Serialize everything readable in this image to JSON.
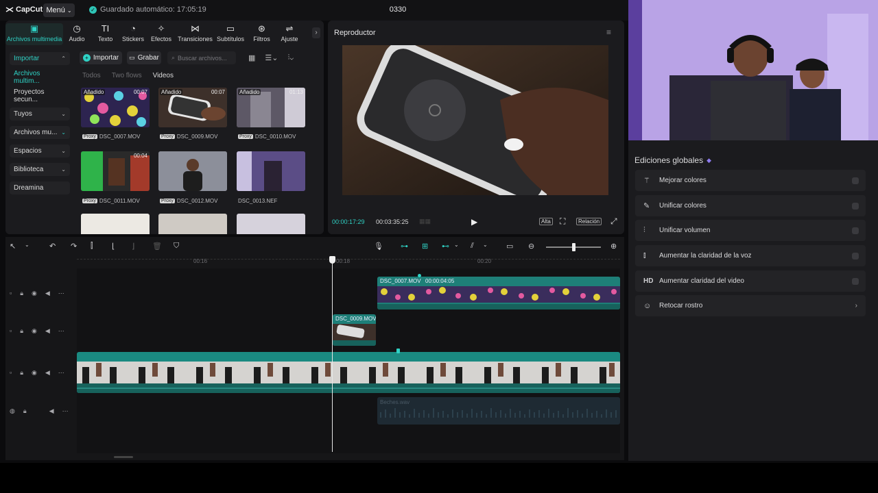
{
  "app": {
    "logo": "CapCut",
    "menu_label": "Menú",
    "autosave": "Guardado automático: 17:05:19",
    "project_title": "0330"
  },
  "toolbar_tabs": [
    {
      "label": "Archivos multimedia",
      "icon": "media-icon"
    },
    {
      "label": "Audio",
      "icon": "audio-icon"
    },
    {
      "label": "Texto",
      "icon": "text-icon"
    },
    {
      "label": "Stickers",
      "icon": "sticker-icon"
    },
    {
      "label": "Efectos",
      "icon": "effects-icon"
    },
    {
      "label": "Transiciones",
      "icon": "transition-icon"
    },
    {
      "label": "Subtítulos",
      "icon": "subtitle-icon"
    },
    {
      "label": "Filtros",
      "icon": "filter-icon"
    },
    {
      "label": "Ajuste",
      "icon": "adjust-icon"
    }
  ],
  "side_nav": [
    {
      "label": "Importar"
    },
    {
      "label": "Archivos multim..."
    },
    {
      "label": "Proyectos secun..."
    },
    {
      "label": "Tuyos"
    },
    {
      "label": "Archivos mu..."
    },
    {
      "label": "Espacios"
    },
    {
      "label": "Biblioteca"
    },
    {
      "label": "Dreamina"
    }
  ],
  "media": {
    "import_label": "Importar",
    "record_label": "Grabar",
    "search_placeholder": "Buscar archivos...",
    "filters": [
      "Todos",
      "Two flows",
      "Videos"
    ],
    "items": [
      {
        "tag": "Añadido",
        "duration": "00:07",
        "name": "DSC_0007.MOV",
        "proxy": "Proxy"
      },
      {
        "tag": "Añadido",
        "duration": "00:07",
        "name": "DSC_0009.MOV",
        "proxy": "Proxy"
      },
      {
        "tag": "Añadido",
        "duration": "01:13",
        "name": "DSC_0010.MOV",
        "proxy": "Proxy"
      },
      {
        "tag": "",
        "duration": "00:04",
        "name": "DSC_0011.MOV",
        "proxy": "Proxy"
      },
      {
        "tag": "",
        "duration": "",
        "name": "DSC_0012.MOV",
        "proxy": "Proxy"
      },
      {
        "tag": "",
        "duration": "",
        "name": "DSC_0013.NEF",
        "proxy": ""
      }
    ]
  },
  "player": {
    "title": "Reproductor",
    "current_time": "00:00:17:29",
    "total_time": "00:03:35:25",
    "quality": "Alta",
    "ratio": "Relación"
  },
  "timeline": {
    "ruler_labels": [
      "00:16",
      "00:18",
      "00:20"
    ],
    "clips": [
      {
        "name": "DSC_0007.MOV",
        "duration": "00:00:04:05"
      },
      {
        "name": "DSC_0009.MOV"
      },
      {
        "name": "Beches.wav"
      }
    ]
  },
  "right_panel": {
    "title": "Ediciones globales",
    "rows": [
      {
        "label": "Mejorar colores",
        "icon": "magic-wand-icon"
      },
      {
        "label": "Unificar colores",
        "icon": "color-picker-icon"
      },
      {
        "label": "Unificar volumen",
        "icon": "volume-sliders-icon"
      },
      {
        "label": "Aumentar la claridad de la voz",
        "icon": "voice-wave-icon"
      },
      {
        "label": "Aumentar claridad del video",
        "icon": "hd-icon"
      },
      {
        "label": "Retocar rostro",
        "icon": "face-retouch-icon"
      }
    ]
  },
  "colors": {
    "accent": "#2fd1c4",
    "panel": "#1b1b1e",
    "clip_teal": "#1f8f86"
  }
}
